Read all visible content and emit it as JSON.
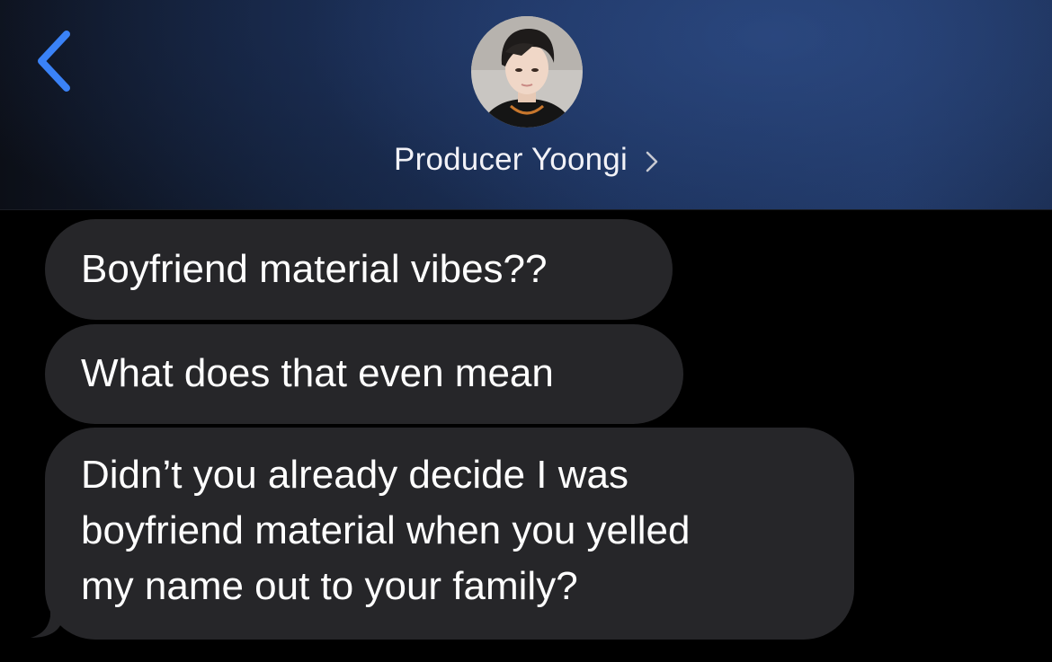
{
  "header": {
    "contact_name": "Producer Yoongi",
    "back_icon": "chevron-left-icon",
    "detail_icon": "chevron-right-icon",
    "accent_color": "#3a82f7"
  },
  "messages": [
    {
      "lines": [
        "Boyfriend material vibes??"
      ]
    },
    {
      "lines": [
        "What does that even mean"
      ]
    },
    {
      "lines": [
        "Didn’t you already decide I was",
        "boyfriend material when you yelled",
        "my name out to your family?"
      ]
    }
  ],
  "colors": {
    "incoming_bubble": "#262629",
    "background": "#000000"
  }
}
